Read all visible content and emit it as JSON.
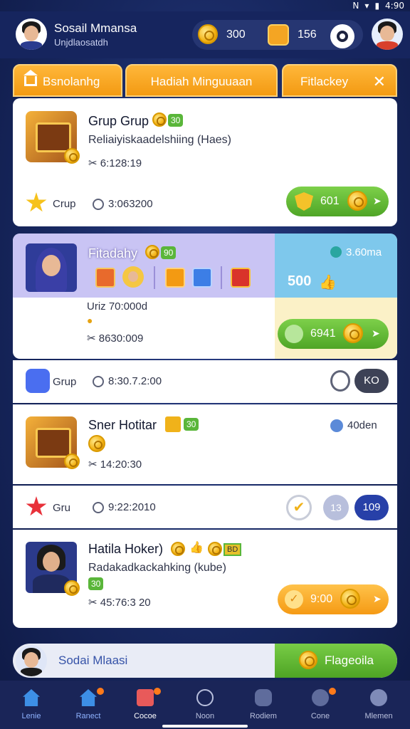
{
  "status_bar": {
    "time": "4:90",
    "signal": "N",
    "wifi": "wifi",
    "battery": "battery"
  },
  "header": {
    "user_name": "Sosail Mmansa",
    "user_sub": "Unjdlaosatdh",
    "coins": "300",
    "gifts": "156"
  },
  "tabs": [
    {
      "label": "Bsnolanhg"
    },
    {
      "label": "Hadiah Minguuaan"
    },
    {
      "label": "Fitlackey"
    }
  ],
  "card1": {
    "title": "Grup Grup",
    "badge": "30",
    "subtitle": "Reliaiyiskaadelshiing (Haes)",
    "time": "6:128:19",
    "footer_label": "Crup",
    "footer_time": "3:063200",
    "button_value": "601"
  },
  "card2": {
    "title": "Fitadahy",
    "badge": "90",
    "right_value": "3.60ma",
    "right_amount": "500",
    "line1": "Uriz 70:000d",
    "time": "8630:009",
    "button_value": "6941"
  },
  "row1": {
    "label": "Grup",
    "time": "8:30.7.2:00",
    "button": "KO"
  },
  "card3": {
    "title": "Sner Hotitar",
    "badge": "30",
    "right_value": "40den",
    "time": "14:20:30"
  },
  "row2": {
    "label": "Gru",
    "time": "9:22:2010",
    "pill_a": "13",
    "pill_b": "109"
  },
  "card4": {
    "title": "Hatila Hoker)",
    "badge_a": "BD",
    "subtitle": "Radakadkackahking (kube)",
    "badge_b": "30",
    "time": "45:76:3 20",
    "button_value": "9:00"
  },
  "bottom_bar": {
    "name": "Sodai Mlaasi",
    "action": "Flageoila"
  },
  "nav": [
    {
      "label": "Lenie",
      "icon": "home-icon"
    },
    {
      "label": "Ranect",
      "icon": "home-icon"
    },
    {
      "label": "Cocoe",
      "icon": "gift-icon"
    },
    {
      "label": "Noon",
      "icon": "star-icon"
    },
    {
      "label": "Rodiem",
      "icon": "chat-icon"
    },
    {
      "label": "Cone",
      "icon": "group-icon"
    },
    {
      "label": "Mlemen",
      "icon": "profile-icon"
    }
  ],
  "colors": {
    "orange": "#f39a12",
    "green": "#5ab63a",
    "navy": "#16255e",
    "lavender": "#c9c4f4",
    "sky": "#7ec8ec"
  }
}
